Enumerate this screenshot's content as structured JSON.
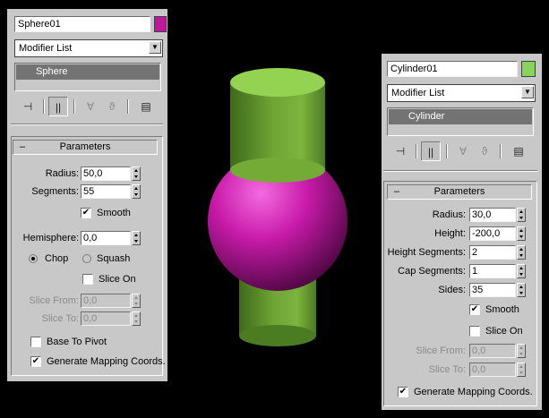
{
  "viewport": {
    "background": "#000000"
  },
  "sphere_panel": {
    "object_name": "Sphere01",
    "color": "#c0189c",
    "modifier_list": "Modifier List",
    "stack_item": "Sphere",
    "rollout_title": "Parameters",
    "radius_label": "Radius:",
    "radius": "50,0",
    "segments_label": "Segments:",
    "segments": "55",
    "smooth_label": "Smooth",
    "hemisphere_label": "Hemisphere:",
    "hemisphere": "0,0",
    "chop_label": "Chop",
    "squash_label": "Squash",
    "slice_on_label": "Slice On",
    "slice_from_label": "Slice From:",
    "slice_from": "0,0",
    "slice_to_label": "Slice To:",
    "slice_to": "0,0",
    "base_to_pivot_label": "Base To Pivot",
    "mapping_label": "Generate Mapping Coords."
  },
  "cylinder_panel": {
    "object_name": "Cylinder01",
    "color": "#88d45a",
    "modifier_list": "Modifier List",
    "stack_item": "Cylinder",
    "rollout_title": "Parameters",
    "radius_label": "Radius:",
    "radius": "30,0",
    "height_label": "Height:",
    "height": "-200,0",
    "height_segments_label": "Height Segments:",
    "height_segments": "2",
    "cap_segments_label": "Cap Segments:",
    "cap_segments": "1",
    "sides_label": "Sides:",
    "sides": "35",
    "smooth_label": "Smooth",
    "slice_on_label": "Slice On",
    "slice_from_label": "Slice From:",
    "slice_from": "0,0",
    "slice_to_label": "Slice To:",
    "slice_to": "0,0",
    "mapping_label": "Generate Mapping Coords."
  }
}
